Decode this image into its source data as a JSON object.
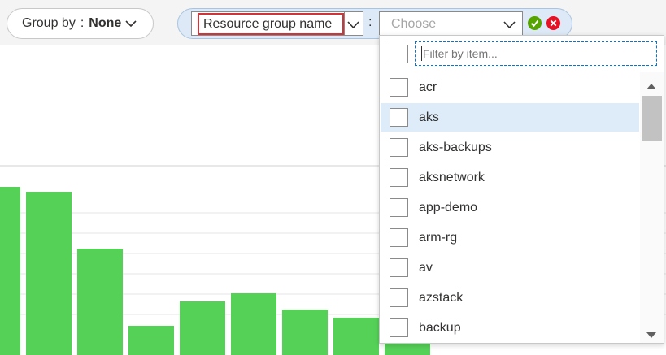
{
  "toolbar": {
    "group_by_label": "Group by",
    "group_by_separator": ":",
    "group_by_value": "None"
  },
  "filter": {
    "property_value": "Resource group name",
    "operator": ":",
    "value_placeholder": "Choose"
  },
  "dropdown": {
    "filter_placeholder": "Filter by item...",
    "items": [
      {
        "label": "acr",
        "selected": false
      },
      {
        "label": "aks",
        "selected": true
      },
      {
        "label": "aks-backups",
        "selected": false
      },
      {
        "label": "aksnetwork",
        "selected": false
      },
      {
        "label": "app-demo",
        "selected": false
      },
      {
        "label": "arm-rg",
        "selected": false
      },
      {
        "label": "av",
        "selected": false
      },
      {
        "label": "azstack",
        "selected": false
      },
      {
        "label": "backup",
        "selected": false
      }
    ]
  },
  "icons": {
    "ok": "checkmark-circle-icon",
    "cancel": "close-circle-icon",
    "chevron": "chevron-down-icon"
  },
  "colors": {
    "bar": "#55d158",
    "accent": "#0078d4",
    "highlight_border": "#d13438",
    "selected_row": "#deecf9",
    "ok": "#57a300",
    "cancel": "#e81123"
  },
  "chart_data": {
    "type": "bar",
    "categories": [
      "",
      "",
      "",
      "",
      "",
      "",
      "",
      "",
      ""
    ],
    "values": [
      207,
      201,
      131,
      36,
      66,
      76,
      56,
      46,
      15
    ],
    "grid": true,
    "legend": "none"
  }
}
